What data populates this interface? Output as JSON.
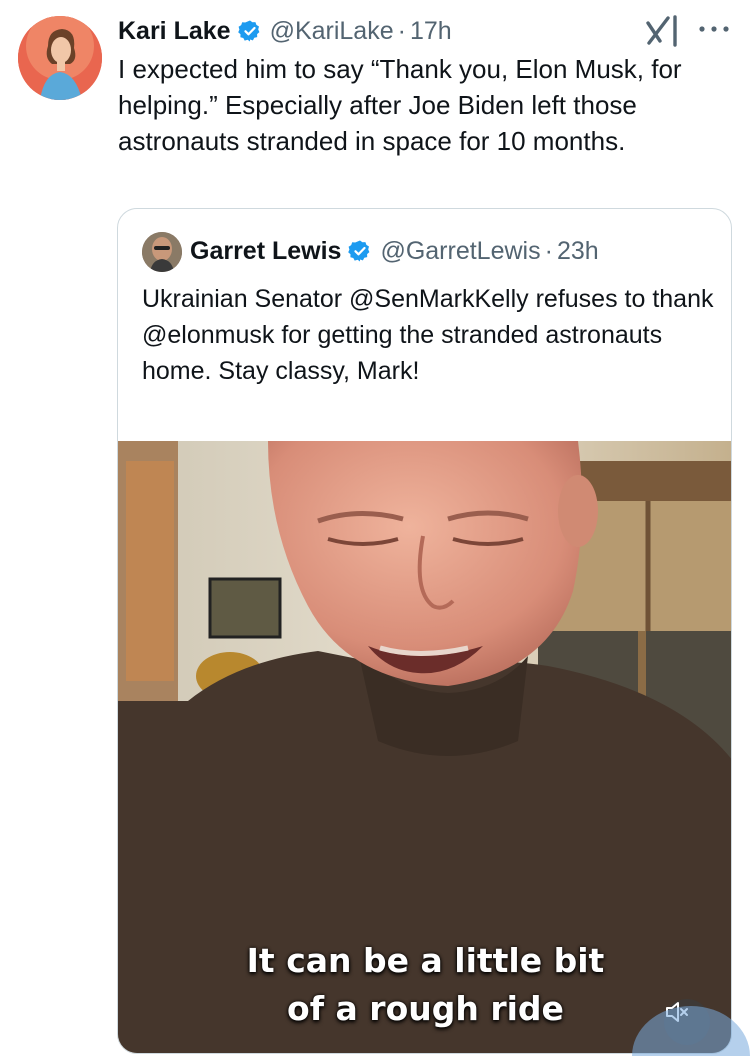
{
  "tweet": {
    "author_name": "Kari Lake",
    "handle": "@KariLake",
    "separator": "·",
    "time": "17h",
    "text": "I expected him to say “Thank you, Elon Musk, for helping.” Especially after Joe Biden left those astronauts stranded in space for 10 months."
  },
  "quoted_tweet": {
    "author_name": "Garret Lewis",
    "handle": "@GarretLewis",
    "separator": "·",
    "time": "23h",
    "text": "Ukrainian Senator @SenMarkKelly refuses to thank @elonmusk for getting the stranded astronauts home. Stay classy, Mark!",
    "video": {
      "caption_line1": "It can be a little bit",
      "caption_line2": "of a rough ride",
      "muted": true
    }
  },
  "colors": {
    "text_primary": "#0f1419",
    "text_secondary": "#536471",
    "verified_blue": "#1d9bf0",
    "border": "#cfd9de"
  },
  "icons": {
    "verified": "verified-badge-icon",
    "grok": "grok-icon",
    "more": "more-options-icon",
    "mute": "speaker-muted-icon"
  }
}
